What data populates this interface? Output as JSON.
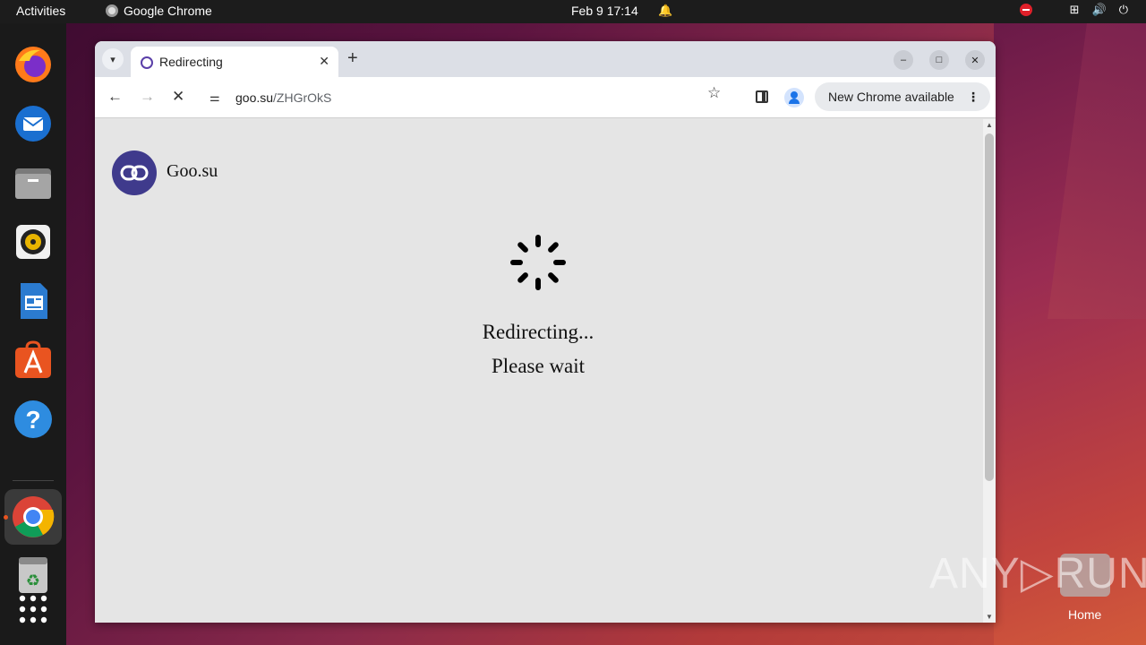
{
  "topbar": {
    "activities": "Activities",
    "app_name": "Google Chrome",
    "datetime": "Feb 9  17:14"
  },
  "dock": {
    "items": [
      "firefox",
      "thunderbird",
      "files",
      "rhythmbox",
      "libreoffice-writer",
      "app-center",
      "help",
      "google-chrome",
      "trash",
      "show-apps"
    ]
  },
  "browser": {
    "tab_title": "Redirecting",
    "url_host": "goo.su",
    "url_path": "/ZHGrOkS",
    "update_label": "New Chrome available"
  },
  "page": {
    "brand": "Goo.su",
    "message_line1": "Redirecting...",
    "message_line2": "Please wait"
  },
  "desktop": {
    "watermark": "ANY▷RUN",
    "home_label": "Home"
  },
  "colors": {
    "logo_bg": "#3f3a8c",
    "page_bg": "#e5e5e5",
    "accent": "#e95420"
  }
}
